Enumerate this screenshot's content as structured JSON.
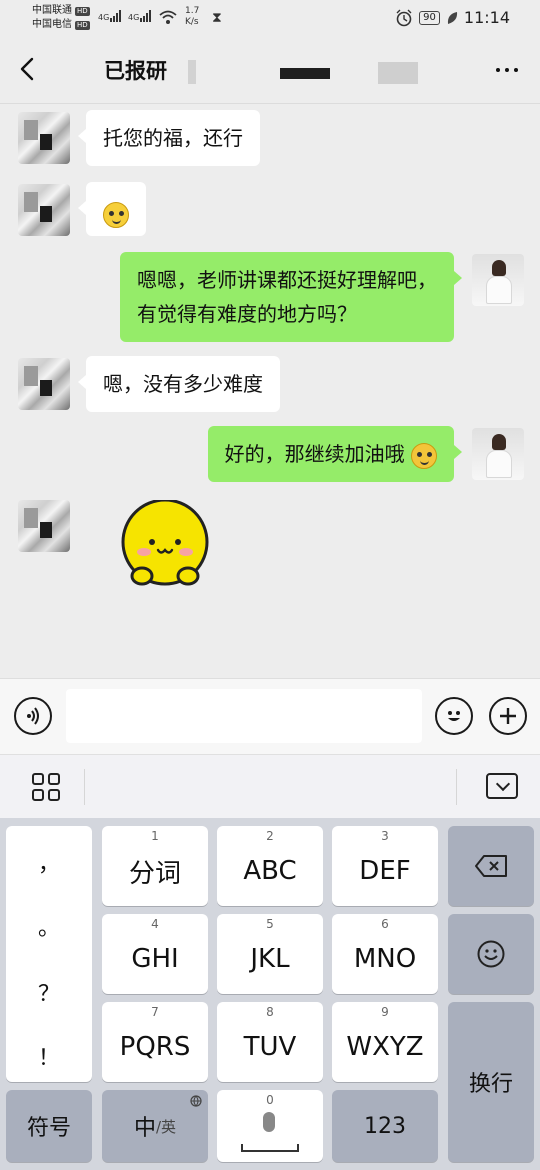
{
  "status_bar": {
    "carrier1": "中国联通",
    "carrier2": "中国电信",
    "hd_badge": "HD",
    "net1": "4G",
    "net2": "4G",
    "speed_value": "1.7",
    "speed_unit": "K/s",
    "battery": "90",
    "time": "11:14"
  },
  "header": {
    "title": "已报研"
  },
  "messages": [
    {
      "side": "left",
      "text": "托您的福，还行"
    },
    {
      "side": "left",
      "text": ""
    },
    {
      "side": "right",
      "line1": "嗯嗯，老师讲课都还挺好理解吧，",
      "line2": "有觉得有难度的地方吗？"
    },
    {
      "side": "left",
      "text": "嗯，没有多少难度"
    },
    {
      "side": "right",
      "text": "好的，那继续加油哦"
    },
    {
      "side": "left",
      "text": ""
    }
  ],
  "input_bar": {
    "voice_icon": "voice-icon",
    "emoji_icon": "emoji-icon",
    "plus_icon": "plus-icon"
  },
  "keyboard": {
    "punctuation": [
      "，",
      "。",
      "？",
      "！"
    ],
    "keys": [
      {
        "num": "1",
        "label": "分词"
      },
      {
        "num": "2",
        "label": "ABC"
      },
      {
        "num": "3",
        "label": "DEF"
      },
      {
        "num": "4",
        "label": "GHI"
      },
      {
        "num": "5",
        "label": "JKL"
      },
      {
        "num": "6",
        "label": "MNO"
      },
      {
        "num": "7",
        "label": "PQRS"
      },
      {
        "num": "8",
        "label": "TUV"
      },
      {
        "num": "9",
        "label": "WXYZ"
      }
    ],
    "symbols": "符号",
    "lang_main": "中",
    "lang_sub": "/英",
    "space_num": "0",
    "num_key": "123",
    "enter": "换行"
  }
}
